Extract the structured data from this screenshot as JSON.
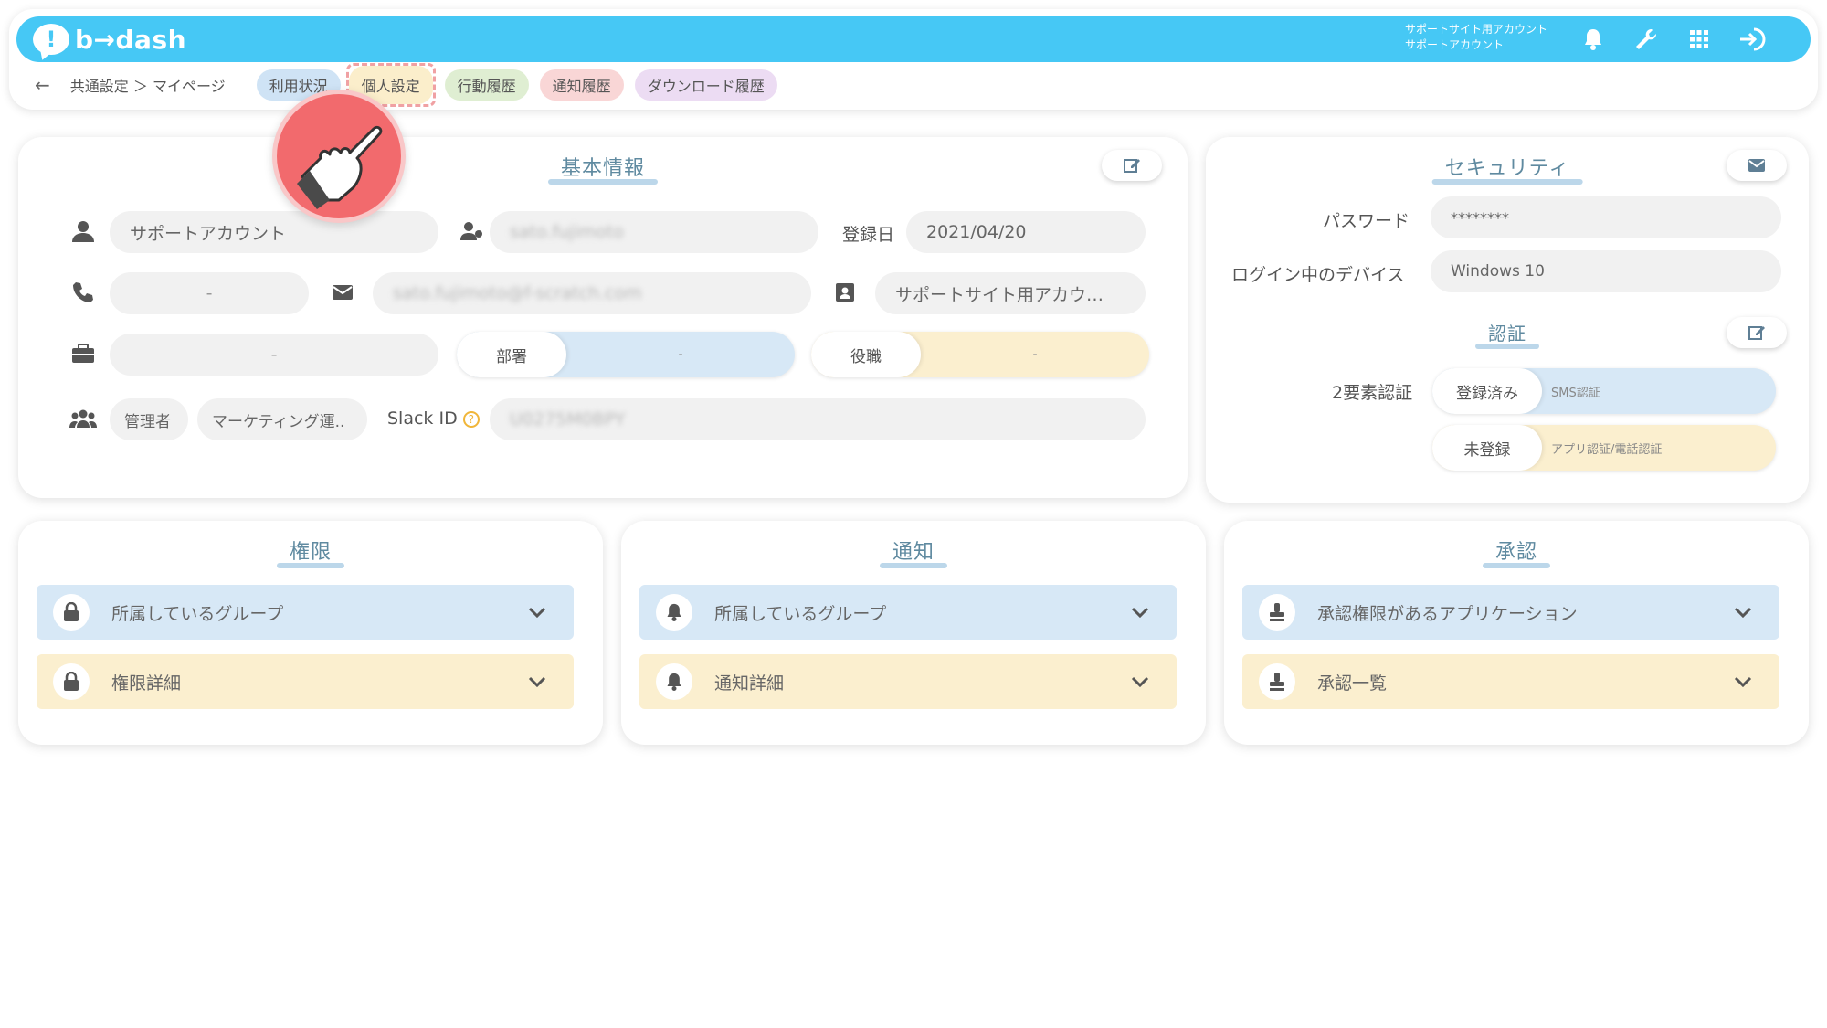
{
  "app": {
    "logo_text": "b→dash"
  },
  "topbar": {
    "account_line1": "サポートサイト用アカウント",
    "account_line2": "サポートアカウント",
    "icons": [
      "bell-icon",
      "wrench-icon",
      "grid-icon",
      "logout-icon"
    ]
  },
  "subnav": {
    "back": "←",
    "breadcrumb": "共通設定 ＞ マイページ",
    "tabs": [
      {
        "label": "利用状況"
      },
      {
        "label": "個人設定"
      },
      {
        "label": "行動履歴"
      },
      {
        "label": "通知履歴"
      },
      {
        "label": "ダウンロード履歴"
      }
    ]
  },
  "basic": {
    "title": "基本情報",
    "name": "サポートアカウント",
    "login_id": "sato.fujimoto",
    "reg_date_label": "登録日",
    "reg_date": "2021/04/20",
    "phone": "-",
    "email": "sato.fujimoto@f-scratch.com",
    "account_type": "サポートサイト用アカウ…",
    "company": "-",
    "dept_label": "部署",
    "dept_value": "-",
    "position_label": "役職",
    "position_value": "-",
    "role": "管理者",
    "team": "マーケティング運..",
    "slack_label": "Slack ID",
    "slack_value": "U0275M0BPY"
  },
  "security": {
    "title": "セキュリティ",
    "password_label": "パスワード",
    "password_value": "********",
    "device_label": "ログイン中のデバイス",
    "device_value": "Windows 10",
    "auth_title": "認証",
    "twofa_label": "2要素認証",
    "sms_status": "登録済み",
    "sms_label": "SMS認証",
    "app_status": "未登録",
    "app_label": "アプリ認証/電話認証"
  },
  "permissions": {
    "title": "権限",
    "item1": "所属しているグループ",
    "item2": "権限詳細"
  },
  "notifications": {
    "title": "通知",
    "item1": "所属しているグループ",
    "item2": "通知詳細"
  },
  "approval": {
    "title": "承認",
    "item1": "承認権限があるアプリケーション",
    "item2": "承認一覧"
  },
  "colors": {
    "brand": "#46c8f5",
    "highlight": "#f26a6d",
    "blue_panel": "#d7e8f6",
    "yellow_panel": "#fbefcf"
  }
}
